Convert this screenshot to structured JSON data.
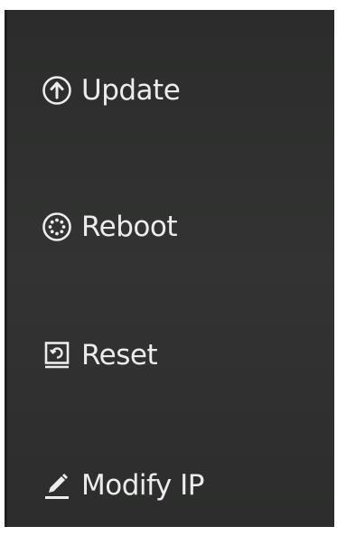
{
  "menu": {
    "items": [
      {
        "id": "update",
        "label": "Update",
        "icon": "arrow-up-circle-icon"
      },
      {
        "id": "reboot",
        "label": "Reboot",
        "icon": "reboot-circle-icon"
      },
      {
        "id": "reset",
        "label": "Reset",
        "icon": "reset-icon"
      },
      {
        "id": "modify_ip",
        "label": "Modify IP",
        "icon": "pencil-icon"
      }
    ]
  },
  "colors": {
    "panel_background": "#2f302f",
    "text": "#ececec"
  }
}
